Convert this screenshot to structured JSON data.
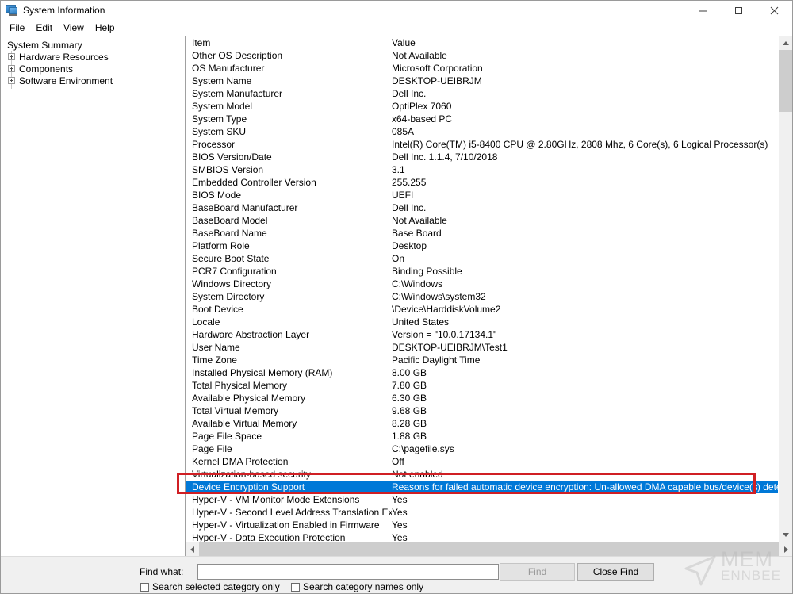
{
  "window": {
    "title": "System Information",
    "icon": "system-information-icon",
    "controls": {
      "minimize": "minimize-icon",
      "maximize": "maximize-icon",
      "close": "close-icon"
    }
  },
  "menu": {
    "items": [
      {
        "label": "File"
      },
      {
        "label": "Edit"
      },
      {
        "label": "View"
      },
      {
        "label": "Help"
      }
    ]
  },
  "tree": {
    "root": {
      "label": "System Summary"
    },
    "children": [
      {
        "label": "Hardware Resources"
      },
      {
        "label": "Components"
      },
      {
        "label": "Software Environment"
      }
    ]
  },
  "list": {
    "columns": {
      "item": "Item",
      "value": "Value"
    },
    "rows": [
      {
        "item": "Other OS Description",
        "value": "Not Available"
      },
      {
        "item": "OS Manufacturer",
        "value": "Microsoft Corporation"
      },
      {
        "item": "System Name",
        "value": "DESKTOP-UEIBRJM"
      },
      {
        "item": "System Manufacturer",
        "value": "Dell Inc."
      },
      {
        "item": "System Model",
        "value": "OptiPlex 7060"
      },
      {
        "item": "System Type",
        "value": "x64-based PC"
      },
      {
        "item": "System SKU",
        "value": "085A"
      },
      {
        "item": "Processor",
        "value": "Intel(R) Core(TM) i5-8400 CPU @ 2.80GHz, 2808 Mhz, 6 Core(s), 6 Logical Processor(s)"
      },
      {
        "item": "BIOS Version/Date",
        "value": "Dell Inc. 1.1.4, 7/10/2018"
      },
      {
        "item": "SMBIOS Version",
        "value": "3.1"
      },
      {
        "item": "Embedded Controller Version",
        "value": "255.255"
      },
      {
        "item": "BIOS Mode",
        "value": "UEFI"
      },
      {
        "item": "BaseBoard Manufacturer",
        "value": "Dell Inc."
      },
      {
        "item": "BaseBoard Model",
        "value": "Not Available"
      },
      {
        "item": "BaseBoard Name",
        "value": "Base Board"
      },
      {
        "item": "Platform Role",
        "value": "Desktop"
      },
      {
        "item": "Secure Boot State",
        "value": "On"
      },
      {
        "item": "PCR7 Configuration",
        "value": "Binding Possible"
      },
      {
        "item": "Windows Directory",
        "value": "C:\\Windows"
      },
      {
        "item": "System Directory",
        "value": "C:\\Windows\\system32"
      },
      {
        "item": "Boot Device",
        "value": "\\Device\\HarddiskVolume2"
      },
      {
        "item": "Locale",
        "value": "United States"
      },
      {
        "item": "Hardware Abstraction Layer",
        "value": "Version = \"10.0.17134.1\""
      },
      {
        "item": "User Name",
        "value": "DESKTOP-UEIBRJM\\Test1"
      },
      {
        "item": "Time Zone",
        "value": "Pacific Daylight Time"
      },
      {
        "item": "Installed Physical Memory (RAM)",
        "value": "8.00 GB"
      },
      {
        "item": "Total Physical Memory",
        "value": "7.80 GB"
      },
      {
        "item": "Available Physical Memory",
        "value": "6.30 GB"
      },
      {
        "item": "Total Virtual Memory",
        "value": "9.68 GB"
      },
      {
        "item": "Available Virtual Memory",
        "value": "8.28 GB"
      },
      {
        "item": "Page File Space",
        "value": "1.88 GB"
      },
      {
        "item": "Page File",
        "value": "C:\\pagefile.sys"
      },
      {
        "item": "Kernel DMA Protection",
        "value": "Off"
      },
      {
        "item": "Virtualization-based security",
        "value": "Not enabled"
      },
      {
        "item": "Device Encryption Support",
        "value": "Reasons for failed automatic device encryption: Un-allowed DMA capable bus/device(s) detected",
        "selected": true
      },
      {
        "item": "Hyper-V - VM Monitor Mode Extensions",
        "value": "Yes"
      },
      {
        "item": "Hyper-V - Second Level Address Translation Extensions",
        "value": "Yes"
      },
      {
        "item": "Hyper-V - Virtualization Enabled in Firmware",
        "value": "Yes"
      },
      {
        "item": "Hyper-V - Data Execution Protection",
        "value": "Yes"
      }
    ]
  },
  "find": {
    "label": "Find what:",
    "input_value": "",
    "input_placeholder": "",
    "find_button": "Find",
    "close_button": "Close Find",
    "checkbox_selected_category": "Search selected category only",
    "checkbox_category_names": "Search category names only"
  },
  "watermark": {
    "line1": "MEM",
    "line2": "ENNBEE",
    "cursor_icon": "cursor-arrow-icon"
  },
  "colors": {
    "selection": "#0078d7",
    "annotation": "#d01f24",
    "window_bg": "#f0f0f0"
  }
}
